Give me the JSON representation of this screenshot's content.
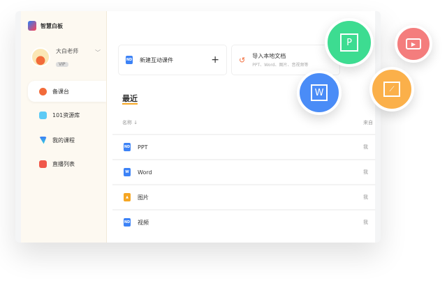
{
  "app": {
    "name": "智慧白板"
  },
  "user": {
    "name": "大白老师",
    "badge": "VIP"
  },
  "sidebar": {
    "items": [
      {
        "label": "备课台"
      },
      {
        "label": "101资源库"
      },
      {
        "label": "我的课程"
      },
      {
        "label": "直播列表"
      }
    ]
  },
  "actions": {
    "new_label": "新建互动课件",
    "new_plus": "+",
    "import_label": "导入本地文档",
    "import_sub": "PPT、Word、图片、音视频等"
  },
  "recent": {
    "title": "最近",
    "col_name": "名称 ↓",
    "col_from": "来自",
    "rows": [
      {
        "name": "PPT",
        "from": "我",
        "icon": "nd"
      },
      {
        "name": "Word",
        "from": "我",
        "icon": "word"
      },
      {
        "name": "图片",
        "from": "我",
        "icon": "image"
      },
      {
        "name": "视频",
        "from": "我",
        "icon": "nd"
      }
    ]
  },
  "badges": {
    "ppt": "P",
    "word": "W"
  },
  "colors": {
    "ppt": "#3ddc91",
    "word": "#4a8cf7",
    "image": "#fbb04a",
    "video": "#f47d7d"
  }
}
